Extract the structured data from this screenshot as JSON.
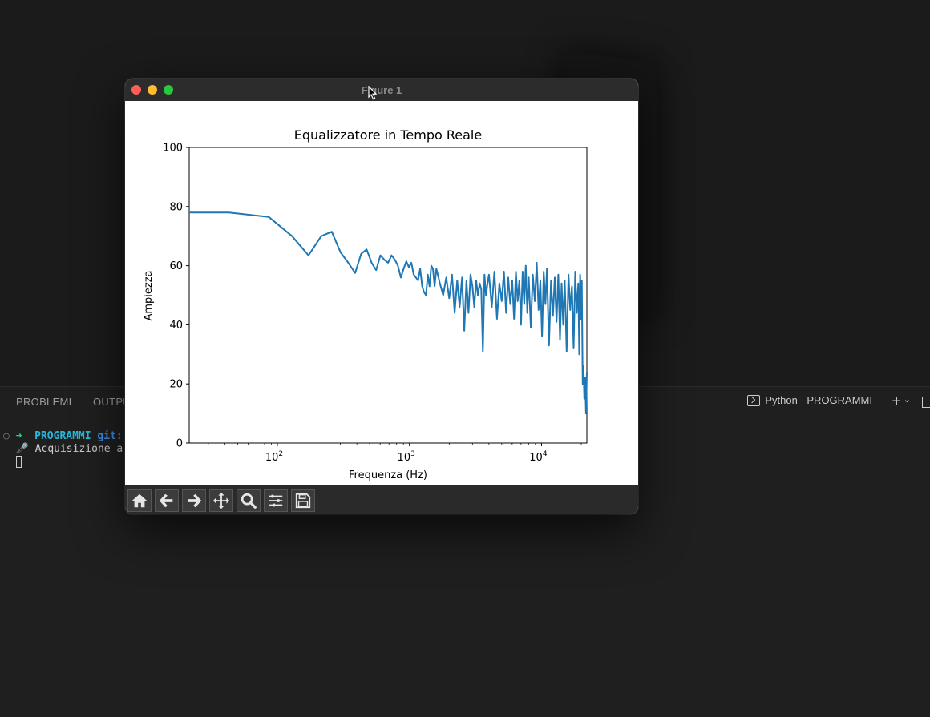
{
  "figure_window": {
    "title": "Figure 1",
    "toolbar": [
      "home-icon",
      "back-icon",
      "forward-icon",
      "pan-icon",
      "zoom-icon",
      "configure-icon",
      "save-icon"
    ]
  },
  "panel": {
    "tab_problems": "PROBLEMI",
    "tab_output": "OUTPU",
    "terminal_name": "Python - PROGRAMMI"
  },
  "terminal": {
    "arrow": "➜",
    "dir": "PROGRAMMI",
    "git": "git:",
    "line2_emoji": "🎤",
    "line2_text": "Acquisizione a"
  },
  "colors": {
    "line": "#1f77b4",
    "panel_bg": "#1f1f1f",
    "titlebar": "#2c2c2c"
  },
  "chart_data": {
    "type": "line",
    "title": "Equalizzatore in Tempo Reale",
    "xlabel": "Frequenza (Hz)",
    "ylabel": "Ampiezza",
    "xscale": "log",
    "xlim": [
      21.5,
      22050
    ],
    "ylim": [
      0,
      100
    ],
    "yticks": [
      0,
      20,
      40,
      60,
      80,
      100
    ],
    "xticks": [
      {
        "value": 100,
        "base": "10",
        "exp": "2"
      },
      {
        "value": 1000,
        "base": "10",
        "exp": "3"
      },
      {
        "value": 10000,
        "base": "10",
        "exp": "4"
      }
    ],
    "grid": false,
    "series": [
      {
        "x": [
          21.5,
          43,
          86,
          129,
          172,
          215,
          258,
          301,
          344,
          388,
          431,
          474,
          517,
          560,
          603,
          646,
          689,
          732,
          775,
          818,
          861,
          904,
          947,
          990,
          1034,
          1077,
          1120,
          1163,
          1206,
          1249,
          1292,
          1335,
          1378,
          1421,
          1464,
          1507,
          1550,
          1600,
          1700,
          1800,
          1900,
          2000,
          2100,
          2200,
          2300,
          2400,
          2500,
          2600,
          2700,
          2800,
          2900,
          3000,
          3100,
          3200,
          3300,
          3400,
          3500,
          3600,
          3700,
          3800,
          3900,
          4000,
          4200,
          4400,
          4600,
          4800,
          5000,
          5200,
          5400,
          5600,
          5800,
          6000,
          6200,
          6400,
          6600,
          6800,
          7000,
          7200,
          7400,
          7600,
          7800,
          8000,
          8300,
          8600,
          8900,
          9200,
          9500,
          9800,
          10100,
          10400,
          10700,
          11000,
          11400,
          11800,
          12200,
          12600,
          13000,
          13400,
          13800,
          14200,
          14600,
          15000,
          15500,
          16000,
          16500,
          17000,
          17500,
          18000,
          18500,
          19000,
          19300,
          19600,
          19900,
          20200,
          20500,
          20800,
          21100,
          21400,
          21700,
          22050
        ],
        "y": [
          78,
          78,
          76.5,
          70,
          63.5,
          70,
          71.5,
          64.5,
          61,
          57.5,
          64,
          65.5,
          61,
          58.5,
          63.5,
          62,
          61,
          63.5,
          62,
          60,
          56,
          59,
          61.5,
          59.5,
          61,
          57,
          56,
          55,
          59,
          53,
          51,
          50,
          57,
          53,
          60,
          59,
          53,
          59,
          54,
          50,
          56,
          49,
          57,
          44,
          55,
          46,
          56,
          38,
          55,
          44,
          57,
          53,
          46,
          55,
          50,
          54,
          52,
          31,
          57,
          50,
          54,
          57,
          46,
          58,
          42,
          54,
          48,
          58,
          44,
          56,
          47,
          55,
          42,
          58,
          48,
          55,
          40,
          58,
          47,
          60,
          44,
          56,
          39,
          57,
          48,
          61,
          45,
          55,
          36,
          58,
          47,
          59,
          33,
          55,
          43,
          56,
          41,
          57,
          35,
          54,
          40,
          55,
          31,
          57,
          45,
          53,
          32,
          58,
          44,
          54,
          30,
          57,
          42,
          55,
          20,
          26,
          15,
          22,
          10,
          24
        ]
      }
    ]
  }
}
